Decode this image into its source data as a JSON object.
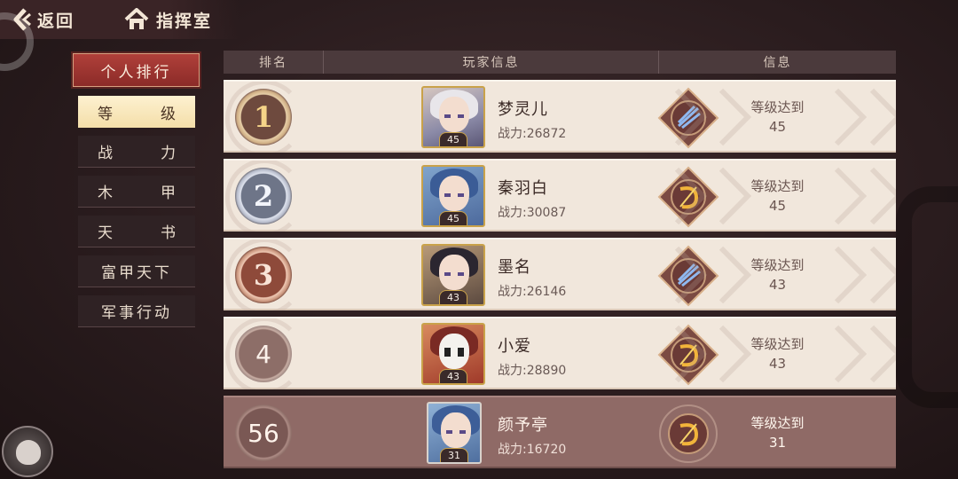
{
  "nav": {
    "back_label": "返回",
    "home_label": "指挥室"
  },
  "sidebar": {
    "header": "个人排行",
    "items": [
      {
        "left": "等",
        "right": "级",
        "active": true
      },
      {
        "left": "战",
        "right": "力",
        "active": false
      },
      {
        "left": "木",
        "right": "甲",
        "active": false
      },
      {
        "left": "天",
        "right": "书",
        "active": false
      },
      {
        "label": "富甲天下",
        "active": false
      },
      {
        "label": "军事行动",
        "active": false
      }
    ]
  },
  "table": {
    "headers": [
      "排名",
      "玩家信息",
      "信息"
    ],
    "rows": [
      {
        "rank": "1",
        "name": "梦灵儿",
        "power": "战力:26872",
        "avatar_level": "45",
        "info_label": "等级达到",
        "info_value": "45",
        "class_icon": "blue-feather-emblem"
      },
      {
        "rank": "2",
        "name": "秦羽白",
        "power": "战力:30087",
        "avatar_level": "45",
        "info_label": "等级达到",
        "info_value": "45",
        "class_icon": "gold-bow-emblem"
      },
      {
        "rank": "3",
        "name": "墨名",
        "power": "战力:26146",
        "avatar_level": "43",
        "info_label": "等级达到",
        "info_value": "43",
        "class_icon": "blue-feather-emblem"
      },
      {
        "rank": "4",
        "name": "小爱",
        "power": "战力:28890",
        "avatar_level": "43",
        "info_label": "等级达到",
        "info_value": "43",
        "class_icon": "gold-bow-emblem"
      }
    ],
    "self_row": {
      "rank": "56",
      "name": "颜予亭",
      "power": "战力:16720",
      "avatar_level": "31",
      "info_label": "等级达到",
      "info_value": "31",
      "class_icon": "gold-bow-emblem"
    }
  },
  "colors": {
    "accent_red": "#9e3631",
    "active_tab": "#f6e2b0",
    "row_bg": "#f1e7dc",
    "self_row_bg": "#8f6a66"
  }
}
